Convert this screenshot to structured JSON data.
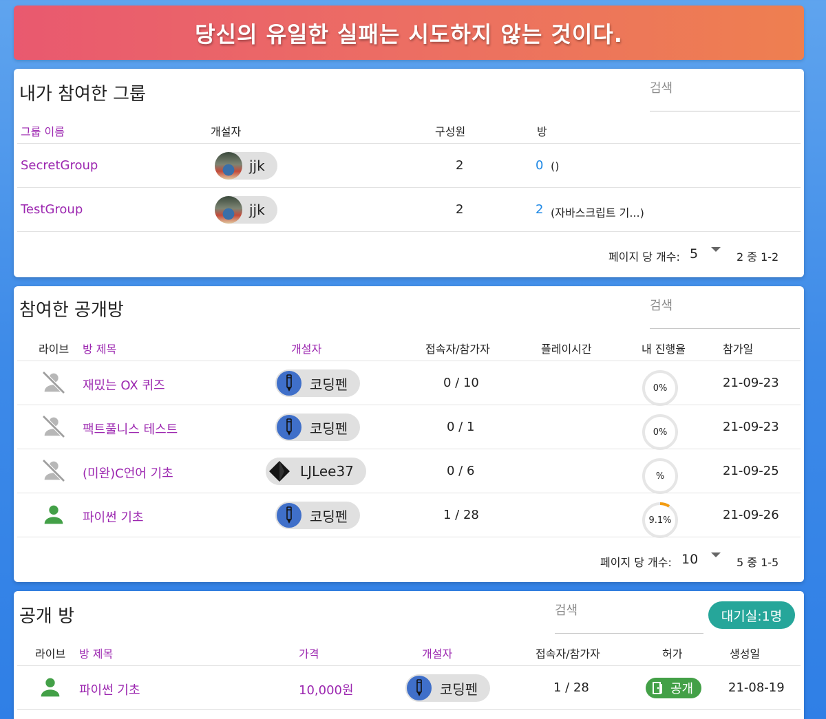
{
  "banner": "당신의 유일한 실패는 시도하지 않는 것이다.",
  "colors": {
    "accent": "#9c27b0",
    "link_blue": "#1e88e5",
    "teal": "#26a69a",
    "green": "#43a047",
    "progress_orange": "#f39c12"
  },
  "my_groups": {
    "title": "내가 참여한 그룹",
    "search_placeholder": "검색",
    "headers": {
      "name": "그룹 이름",
      "owner": "개설자",
      "members": "구성원",
      "rooms": "방"
    },
    "rows": [
      {
        "name": "SecretGroup",
        "owner": "jjk",
        "members": "2",
        "room_count": "0",
        "room_names": "()"
      },
      {
        "name": "TestGroup",
        "owner": "jjk",
        "members": "2",
        "room_count": "2",
        "room_names": "(자바스크립트 기...)"
      }
    ],
    "pager": {
      "label": "페이지 당 개수:",
      "per_page": "5",
      "range": "2 중 1-2"
    }
  },
  "joined_public_rooms": {
    "title": "참여한 공개방",
    "search_placeholder": "검색",
    "headers": {
      "live": "라이브",
      "title": "방 제목",
      "owner": "개설자",
      "users": "접속자/참가자",
      "playtime": "플레이시간",
      "progress": "내 진행율",
      "joined": "참가일"
    },
    "rows": [
      {
        "live": false,
        "live_icon": "person-off-icon",
        "title": "재밌는 OX 퀴즈",
        "owner": "코딩펜",
        "owner_avatar": "pen-icon",
        "users": "0 / 10",
        "playtime": "",
        "progress_label": "0%",
        "progress": 0,
        "joined": "21-09-23"
      },
      {
        "live": false,
        "live_icon": "person-off-icon",
        "title": "팩트풀니스 테스트",
        "owner": "코딩펜",
        "owner_avatar": "pen-icon",
        "users": "0 / 1",
        "playtime": "",
        "progress_label": "0%",
        "progress": 0,
        "joined": "21-09-23"
      },
      {
        "live": false,
        "live_icon": "person-off-icon",
        "title": "(미완)C언어 기초",
        "owner": "LJLee37",
        "owner_avatar": "gem-icon",
        "users": "0 / 6",
        "playtime": "",
        "progress_label": "%",
        "progress": 0,
        "joined": "21-09-25"
      },
      {
        "live": true,
        "live_icon": "person-icon",
        "title": "파이썬 기초",
        "owner": "코딩펜",
        "owner_avatar": "pen-icon",
        "users": "1 / 28",
        "playtime": "",
        "progress_label": "9.1%",
        "progress": 0.091,
        "joined": "21-09-26"
      }
    ],
    "pager": {
      "label": "페이지 당 개수:",
      "per_page": "10",
      "range": "5 중 1-5"
    }
  },
  "public_rooms": {
    "title": "공개 방",
    "search_placeholder": "검색",
    "waiting_button": "대기실:1명",
    "headers": {
      "live": "라이브",
      "title": "방 제목",
      "price": "가격",
      "owner": "개설자",
      "users": "접속자/참가자",
      "permission": "허가",
      "created": "생성일"
    },
    "rows": [
      {
        "live": true,
        "live_icon": "person-icon",
        "title": "파이썬 기초",
        "price": "10,000원",
        "owner": "코딩펜",
        "owner_avatar": "pen-icon",
        "users": "1 / 28",
        "permission": "공개",
        "permission_icon": "door-icon",
        "created": "21-08-19"
      }
    ]
  }
}
